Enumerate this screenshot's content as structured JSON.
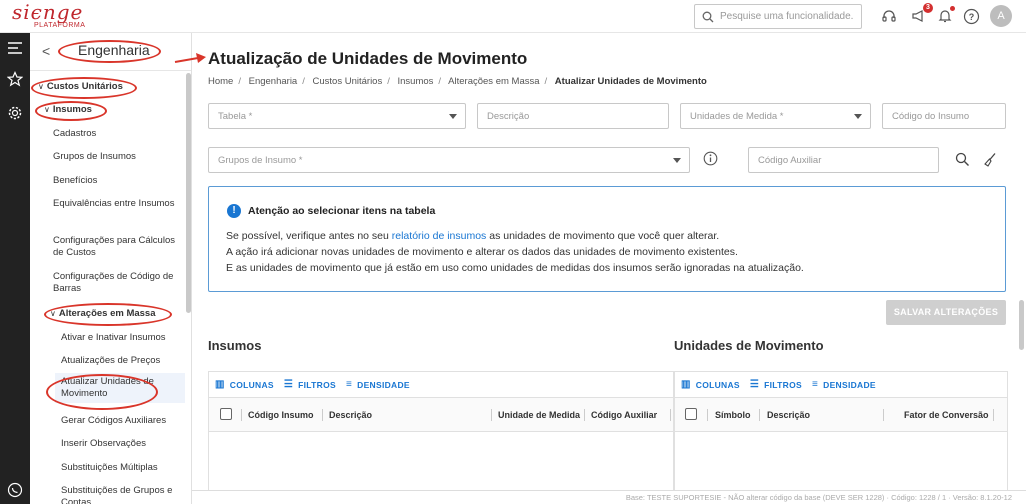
{
  "app": {
    "logo_main": "siєnge",
    "logo_sub": "PLATAFORMA",
    "search_placeholder": "Pesquise uma funcionalidade.",
    "notification_count": "3",
    "avatar_initial": "A"
  },
  "sidebar": {
    "title": "Engenharia",
    "back_glyph": "<",
    "items": [
      {
        "label": "Custos Unitários"
      },
      {
        "label": "Insumos"
      },
      {
        "label": "Cadastros"
      },
      {
        "label": "Grupos de Insumos"
      },
      {
        "label": "Benefícios"
      },
      {
        "label": "Equivalências entre Insumos"
      },
      {
        "label": "Configurações para Cálculos de Custos"
      },
      {
        "label": "Configurações de Código de Barras"
      },
      {
        "label": "Alterações em Massa"
      },
      {
        "label": "Ativar e Inativar Insumos"
      },
      {
        "label": "Atualizações de Preços"
      },
      {
        "label": "Atualizar Unidades de Movimento"
      },
      {
        "label": "Gerar Códigos Auxiliares"
      },
      {
        "label": "Inserir Observações"
      },
      {
        "label": "Substituições Múltiplas"
      },
      {
        "label": "Substituições de Grupos e Contas"
      }
    ]
  },
  "page": {
    "title": "Atualização de Unidades de Movimento",
    "breadcrumb": [
      "Home",
      "Engenharia",
      "Custos Unitários",
      "Insumos",
      "Alterações em Massa"
    ],
    "breadcrumb_current": "Atualizar Unidades de Movimento"
  },
  "filters": {
    "tabela": "Tabela *",
    "descricao": "Descrição",
    "unidades": "Unidades de Medida *",
    "codigo_insumo": "Código do Insumo",
    "grupos": "Grupos de Insumo *",
    "codigo_auxiliar": "Código Auxiliar"
  },
  "alert": {
    "title": "Atenção ao selecionar itens na tabela",
    "line1_pre": "Se possível, verifique antes no seu ",
    "line1_link": "relatório de insumos",
    "line1_post": " as unidades de movimento que você quer alterar.",
    "line2": "A ação irá adicionar novas unidades de movimento e alterar os dados das unidades de movimento existentes.",
    "line3": "E as unidades de movimento que já estão em uso como unidades de medidas dos insumos serão ignoradas na atualização."
  },
  "save_button": "SALVAR ALTERAÇÕES",
  "insumos": {
    "title": "Insumos",
    "toolbar": {
      "colunas": "COLUNAS",
      "filtros": "FILTROS",
      "densidade": "DENSIDADE"
    },
    "columns": [
      "Código Insumo",
      "Descrição",
      "Unidade de Medida",
      "Código Auxiliar"
    ]
  },
  "unidades_mov": {
    "title": "Unidades de Movimento",
    "toolbar": {
      "colunas": "COLUNAS",
      "filtros": "FILTROS",
      "densidade": "DENSIDADE"
    },
    "columns": [
      "Símbolo",
      "Descrição",
      "Fator de Conversão"
    ]
  },
  "footer": "Base: TESTE SUPORTESIE - NÃO alterar código da base (DEVE SER 1228) · Código: 1228 / 1 · Versão: 8.1.20-12",
  "colors": {
    "accent": "#1976d2",
    "brand": "#c0272d",
    "annotation": "#d9352a"
  }
}
